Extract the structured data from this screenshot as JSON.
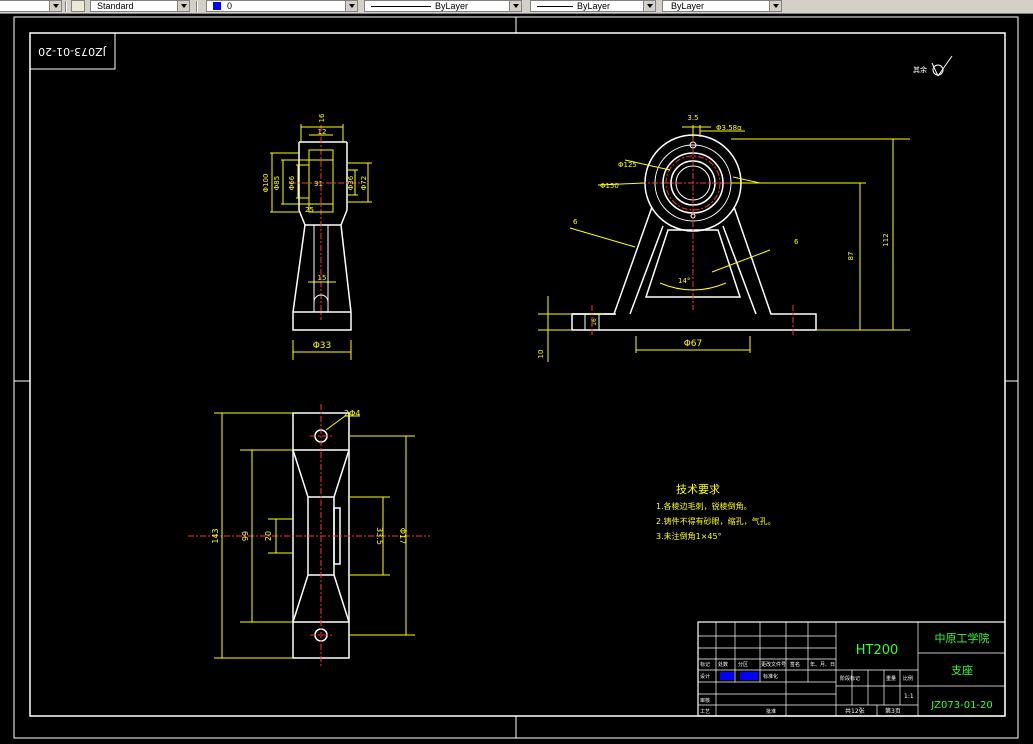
{
  "toolbar": {
    "text_style": "Standard",
    "layer_name": "0",
    "linetype": "ByLayer",
    "lineweight": "ByLayer",
    "plotstyle": "ByLayer"
  },
  "drawing": {
    "drawing_code_mirrored": "JZ073-01-20",
    "roughness_note": "其余",
    "tech_req_title": "技术要求",
    "tech_req_items": [
      "1.各棱边毛刺，锐棱倒角。",
      "2.铸件不得有砂眼，缩孔，气孔。",
      "3.未注倒角1×45°"
    ],
    "dims_side": {
      "d16": "16",
      "d12": "12",
      "d100": "Φ100",
      "d85": "Φ85",
      "d66": "Φ66",
      "d72": "Φ72",
      "d36": "Φ36",
      "d31": "31",
      "d15": "15",
      "d33": "Φ33",
      "d25": "25"
    },
    "dims_front": {
      "d35": "3.5",
      "d358": "Φ3.58α",
      "d125": "Φ125",
      "d150": "Φ150",
      "d6a": "6",
      "d6b": "6",
      "d87": "87",
      "d112": "112",
      "d14": "14°",
      "d67": "Φ67",
      "d10": "10",
      "d16": "16"
    },
    "dims_top": {
      "d143": "143",
      "d99": "99",
      "d20": "20",
      "d335": "33.5",
      "d17": "Φ17",
      "d24": "2Φ4"
    }
  },
  "title_block": {
    "material": "HT200",
    "school": "中原工学院",
    "part_name": "支座",
    "drawing_no": "JZ073-01-20",
    "scale": "1:1",
    "sheets": "共12张",
    "sheet_no": "第3页",
    "headers": [
      "标记",
      "处数",
      "分区",
      "更改文件号",
      "签名",
      "年、月、日"
    ],
    "rows": [
      "设计",
      "审核",
      "工艺",
      "标准化",
      "批准"
    ],
    "stage_headers": [
      "阶段标记",
      "重量",
      "比例"
    ]
  }
}
